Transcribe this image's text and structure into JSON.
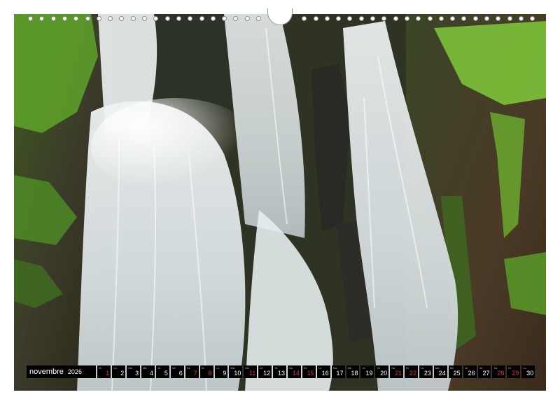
{
  "calendar": {
    "month": "novembre",
    "year": "2026",
    "days": [
      {
        "dow": "Di",
        "num": "1",
        "weekend": true
      },
      {
        "dow": "Lu",
        "num": "2",
        "weekend": false
      },
      {
        "dow": "Ma",
        "num": "3",
        "weekend": false
      },
      {
        "dow": "Me",
        "num": "4",
        "weekend": false
      },
      {
        "dow": "Je",
        "num": "5",
        "weekend": false
      },
      {
        "dow": "Ve",
        "num": "6",
        "weekend": false
      },
      {
        "dow": "Sa",
        "num": "7",
        "weekend": true
      },
      {
        "dow": "Di",
        "num": "8",
        "weekend": true
      },
      {
        "dow": "Lu",
        "num": "9",
        "weekend": false
      },
      {
        "dow": "Ma",
        "num": "10",
        "weekend": false
      },
      {
        "dow": "Me",
        "num": "11",
        "weekend": true
      },
      {
        "dow": "Je",
        "num": "12",
        "weekend": false
      },
      {
        "dow": "Ve",
        "num": "13",
        "weekend": false
      },
      {
        "dow": "Sa",
        "num": "14",
        "weekend": true
      },
      {
        "dow": "Di",
        "num": "15",
        "weekend": true
      },
      {
        "dow": "Lu",
        "num": "16",
        "weekend": false
      },
      {
        "dow": "Ma",
        "num": "17",
        "weekend": false
      },
      {
        "dow": "Me",
        "num": "18",
        "weekend": false
      },
      {
        "dow": "Je",
        "num": "19",
        "weekend": false
      },
      {
        "dow": "Ve",
        "num": "20",
        "weekend": false
      },
      {
        "dow": "Sa",
        "num": "21",
        "weekend": true
      },
      {
        "dow": "Di",
        "num": "22",
        "weekend": true
      },
      {
        "dow": "Lu",
        "num": "23",
        "weekend": false
      },
      {
        "dow": "Ma",
        "num": "24",
        "weekend": false
      },
      {
        "dow": "Me",
        "num": "25",
        "weekend": false
      },
      {
        "dow": "Je",
        "num": "26",
        "weekend": false
      },
      {
        "dow": "Ve",
        "num": "27",
        "weekend": false
      },
      {
        "dow": "Sa",
        "num": "28",
        "weekend": true
      },
      {
        "dow": "Di",
        "num": "29",
        "weekend": true
      },
      {
        "dow": "Lu",
        "num": "30",
        "weekend": false
      }
    ]
  },
  "colors": {
    "strip_bg": "#000000",
    "weekend": "#d63a3a",
    "foliage": "#6fb52c",
    "water": "#e8eef0"
  }
}
